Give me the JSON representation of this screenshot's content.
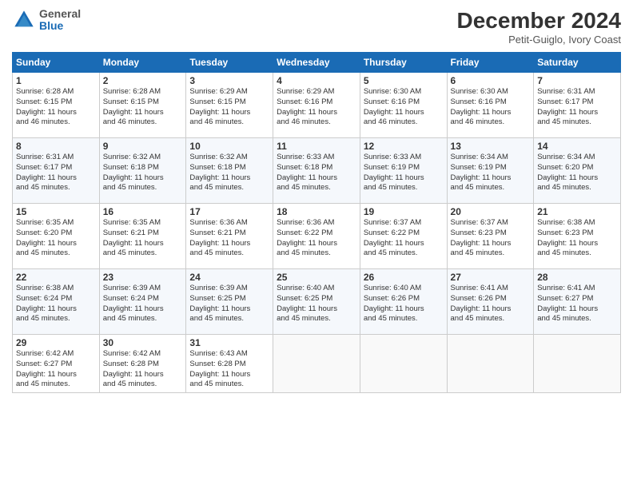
{
  "header": {
    "logo_line1": "General",
    "logo_line2": "Blue",
    "month_year": "December 2024",
    "location": "Petit-Guiglo, Ivory Coast"
  },
  "days_of_week": [
    "Sunday",
    "Monday",
    "Tuesday",
    "Wednesday",
    "Thursday",
    "Friday",
    "Saturday"
  ],
  "weeks": [
    [
      {
        "day": 1,
        "sunrise": "6:28 AM",
        "sunset": "6:15 PM",
        "hours": "11",
        "mins": "46"
      },
      {
        "day": 2,
        "sunrise": "6:28 AM",
        "sunset": "6:15 PM",
        "hours": "11",
        "mins": "46"
      },
      {
        "day": 3,
        "sunrise": "6:29 AM",
        "sunset": "6:15 PM",
        "hours": "11",
        "mins": "46"
      },
      {
        "day": 4,
        "sunrise": "6:29 AM",
        "sunset": "6:16 PM",
        "hours": "11",
        "mins": "46"
      },
      {
        "day": 5,
        "sunrise": "6:30 AM",
        "sunset": "6:16 PM",
        "hours": "11",
        "mins": "46"
      },
      {
        "day": 6,
        "sunrise": "6:30 AM",
        "sunset": "6:16 PM",
        "hours": "11",
        "mins": "46"
      },
      {
        "day": 7,
        "sunrise": "6:31 AM",
        "sunset": "6:17 PM",
        "hours": "11",
        "mins": "45"
      }
    ],
    [
      {
        "day": 8,
        "sunrise": "6:31 AM",
        "sunset": "6:17 PM",
        "hours": "11",
        "mins": "45"
      },
      {
        "day": 9,
        "sunrise": "6:32 AM",
        "sunset": "6:18 PM",
        "hours": "11",
        "mins": "45"
      },
      {
        "day": 10,
        "sunrise": "6:32 AM",
        "sunset": "6:18 PM",
        "hours": "11",
        "mins": "45"
      },
      {
        "day": 11,
        "sunrise": "6:33 AM",
        "sunset": "6:18 PM",
        "hours": "11",
        "mins": "45"
      },
      {
        "day": 12,
        "sunrise": "6:33 AM",
        "sunset": "6:19 PM",
        "hours": "11",
        "mins": "45"
      },
      {
        "day": 13,
        "sunrise": "6:34 AM",
        "sunset": "6:19 PM",
        "hours": "11",
        "mins": "45"
      },
      {
        "day": 14,
        "sunrise": "6:34 AM",
        "sunset": "6:20 PM",
        "hours": "11",
        "mins": "45"
      }
    ],
    [
      {
        "day": 15,
        "sunrise": "6:35 AM",
        "sunset": "6:20 PM",
        "hours": "11",
        "mins": "45"
      },
      {
        "day": 16,
        "sunrise": "6:35 AM",
        "sunset": "6:21 PM",
        "hours": "11",
        "mins": "45"
      },
      {
        "day": 17,
        "sunrise": "6:36 AM",
        "sunset": "6:21 PM",
        "hours": "11",
        "mins": "45"
      },
      {
        "day": 18,
        "sunrise": "6:36 AM",
        "sunset": "6:22 PM",
        "hours": "11",
        "mins": "45"
      },
      {
        "day": 19,
        "sunrise": "6:37 AM",
        "sunset": "6:22 PM",
        "hours": "11",
        "mins": "45"
      },
      {
        "day": 20,
        "sunrise": "6:37 AM",
        "sunset": "6:23 PM",
        "hours": "11",
        "mins": "45"
      },
      {
        "day": 21,
        "sunrise": "6:38 AM",
        "sunset": "6:23 PM",
        "hours": "11",
        "mins": "45"
      }
    ],
    [
      {
        "day": 22,
        "sunrise": "6:38 AM",
        "sunset": "6:24 PM",
        "hours": "11",
        "mins": "45"
      },
      {
        "day": 23,
        "sunrise": "6:39 AM",
        "sunset": "6:24 PM",
        "hours": "11",
        "mins": "45"
      },
      {
        "day": 24,
        "sunrise": "6:39 AM",
        "sunset": "6:25 PM",
        "hours": "11",
        "mins": "45"
      },
      {
        "day": 25,
        "sunrise": "6:40 AM",
        "sunset": "6:25 PM",
        "hours": "11",
        "mins": "45"
      },
      {
        "day": 26,
        "sunrise": "6:40 AM",
        "sunset": "6:26 PM",
        "hours": "11",
        "mins": "45"
      },
      {
        "day": 27,
        "sunrise": "6:41 AM",
        "sunset": "6:26 PM",
        "hours": "11",
        "mins": "45"
      },
      {
        "day": 28,
        "sunrise": "6:41 AM",
        "sunset": "6:27 PM",
        "hours": "11",
        "mins": "45"
      }
    ],
    [
      {
        "day": 29,
        "sunrise": "6:42 AM",
        "sunset": "6:27 PM",
        "hours": "11",
        "mins": "45"
      },
      {
        "day": 30,
        "sunrise": "6:42 AM",
        "sunset": "6:28 PM",
        "hours": "11",
        "mins": "45"
      },
      {
        "day": 31,
        "sunrise": "6:43 AM",
        "sunset": "6:28 PM",
        "hours": "11",
        "mins": "45"
      },
      null,
      null,
      null,
      null
    ]
  ],
  "labels": {
    "sunrise": "Sunrise:",
    "sunset": "Sunset:",
    "daylight": "Daylight:",
    "hours_suffix": "hours",
    "and": "and",
    "minutes_suffix": "minutes."
  }
}
